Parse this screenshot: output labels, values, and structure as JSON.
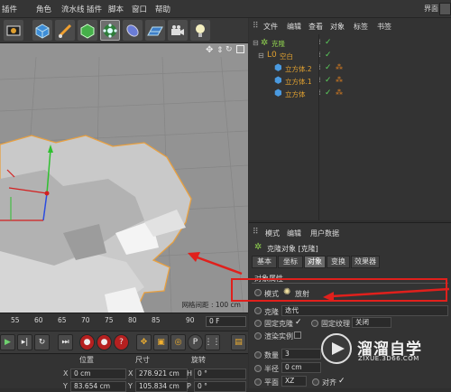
{
  "menubar": {
    "items": [
      "插件",
      "角色",
      "流水线",
      "插件",
      "脚本",
      "窗口",
      "帮助"
    ],
    "layout_label": "界面"
  },
  "toolbar": {
    "tools": [
      "render-view-icon",
      "cube-icon",
      "pen-icon",
      "subdivision-icon",
      "cloner-icon",
      "deformer-icon",
      "floor-icon",
      "camera-icon",
      "light-icon"
    ]
  },
  "viewport": {
    "grid_spacing": "网格间距 : 100 cm"
  },
  "timeline": {
    "ticks": [
      "55",
      "60",
      "65",
      "70",
      "75",
      "80",
      "85",
      "90"
    ],
    "current_frame": "0 F"
  },
  "coordinates": {
    "headers": [
      "位置",
      "尺寸",
      "旋转"
    ],
    "rows": [
      {
        "axis1": "X",
        "pos": "0 cm",
        "axis2": "X",
        "size": "278.921 cm",
        "rot_label": "H",
        "rot": "0 °"
      },
      {
        "axis1": "Y",
        "pos": "83.654 cm",
        "axis2": "Y",
        "size": "105.834 cm",
        "rot_label": "P",
        "rot": "0 °"
      }
    ]
  },
  "object_manager": {
    "menu": [
      "文件",
      "编辑",
      "查看",
      "对象",
      "标签",
      "书签"
    ],
    "objects": [
      {
        "name": "克隆",
        "color": "#8fd14f",
        "depth": 0
      },
      {
        "name": "空白",
        "color": "#e0a030",
        "depth": 1
      },
      {
        "name": "立方体.2",
        "color": "#e0a030",
        "depth": 2
      },
      {
        "name": "立方体.1",
        "color": "#e0a030",
        "depth": 2
      },
      {
        "name": "立方体",
        "color": "#e0a030",
        "depth": 2
      }
    ]
  },
  "attributes": {
    "menu": [
      "模式",
      "编辑",
      "用户数据"
    ],
    "object_title": "克隆对象 [克隆]",
    "tabs": [
      "基本",
      "坐标",
      "对象",
      "变换",
      "效果器"
    ],
    "active_tab": "对象",
    "section_title": "对象属性",
    "mode_label": "模式",
    "mode_value": "放射",
    "clone_label": "克隆",
    "clone_value": "迭代",
    "fix_clone_label": "固定克隆",
    "fix_texture_label": "固定纹理",
    "fix_texture_value": "关闭",
    "render_instances_label": "渲染实例",
    "count_label": "数量",
    "count_value": "3",
    "radius_label": "半径",
    "radius_value": "0 cm",
    "plane_label": "平面",
    "plane_value": "XZ",
    "align_label": "对齐"
  },
  "watermark": {
    "title": "溜溜自学",
    "url": "ZIXUE.3D66.COM"
  },
  "colors": {
    "annotation_arrow": "#e0201c",
    "selection_outline": "#e8a040",
    "active_tab": "#6a6a6a"
  }
}
